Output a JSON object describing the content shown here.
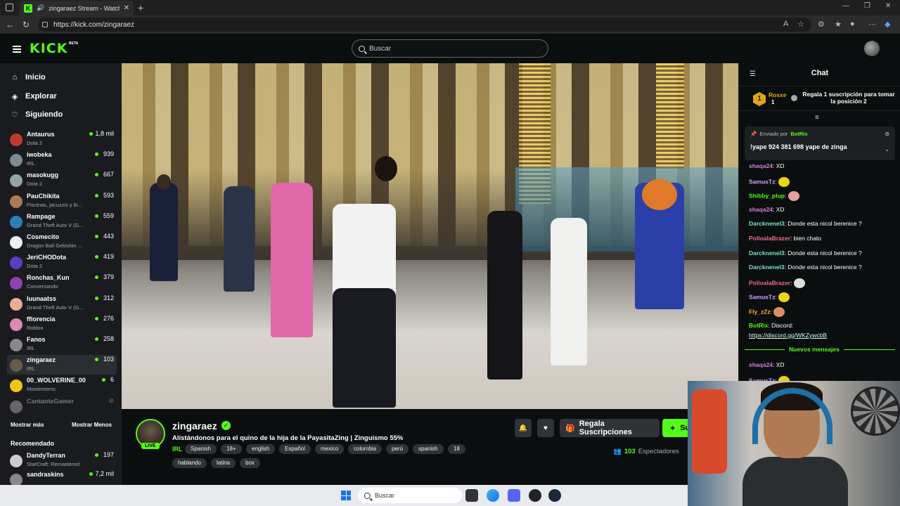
{
  "browser": {
    "tab_title": "zingaraez Stream - Watch Li",
    "url": "https://kick.com/zingaraez"
  },
  "header": {
    "logo": "KICK",
    "beta": "BETA",
    "search_placeholder": "Buscar"
  },
  "sidebar": {
    "nav": [
      {
        "label": "Inicio",
        "icon": "home-icon"
      },
      {
        "label": "Explorar",
        "icon": "compass-icon"
      },
      {
        "label": "Siguiendo",
        "icon": "heart-icon"
      }
    ],
    "channels": [
      {
        "name": "Antaurus",
        "category": "Dota 2",
        "viewers": "1,8 mil",
        "color": "#c0392b"
      },
      {
        "name": "iwobeka",
        "category": "IRL",
        "viewers": "939",
        "color": "#7f8c8d"
      },
      {
        "name": "masokugg",
        "category": "Dota 2",
        "viewers": "667",
        "color": "#95a5a6"
      },
      {
        "name": "PauChikita",
        "category": "Piscinas, jacuzzis y bi...",
        "viewers": "593",
        "color": "#b07a52"
      },
      {
        "name": "Rampage",
        "category": "Grand Theft Auto V (G...",
        "viewers": "559",
        "color": "#2980b9"
      },
      {
        "name": "Cosmecito",
        "category": "Dragon Ball Gekishin ...",
        "viewers": "443",
        "color": "#ecf0f1"
      },
      {
        "name": "JeriCHODota",
        "category": "Dota 2",
        "viewers": "419",
        "color": "#5b3cc4"
      },
      {
        "name": "Ronchas_Kun",
        "category": "Conversando",
        "viewers": "379",
        "color": "#8e44ad"
      },
      {
        "name": "luunaatss",
        "category": "Grand Theft Auto V (G...",
        "viewers": "312",
        "color": "#e8b090"
      },
      {
        "name": "ffiorencia",
        "category": "Roblox",
        "viewers": "276",
        "color": "#d98ab0"
      },
      {
        "name": "Fanos",
        "category": "IRL",
        "viewers": "258",
        "color": "#888888"
      },
      {
        "name": "zingaraez",
        "category": "IRL",
        "viewers": "103",
        "color": "#6a5a48",
        "active": true
      },
      {
        "name": "00_WOLVERINE_00",
        "category": "Movierooms",
        "viewers": "6",
        "color": "#f1c40f"
      },
      {
        "name": "CantanteGamer",
        "category": "",
        "viewers": "",
        "color": "#666666",
        "offline": true
      }
    ],
    "show_more": "Mostrar más",
    "show_less": "Mostrar Menos",
    "recommended_title": "Recomendado",
    "recommended": [
      {
        "name": "DandyTerran",
        "category": "StarCraft: Remastered",
        "viewers": "197",
        "color": "#cccccc"
      },
      {
        "name": "sandraskins",
        "category": "",
        "viewers": "7,2 mil",
        "color": "#888888"
      }
    ]
  },
  "stream": {
    "name": "zingaraez",
    "live_label": "LIVE",
    "title": "Alistándonos para el quino de la hija de la PayasitaZing  | Zinguismo 55%",
    "category": "IRL",
    "tags": [
      "Spanish",
      "18+",
      "english",
      "Español",
      "mexico",
      "colombia",
      "perú",
      "spanish",
      "18",
      "hablando",
      "latina",
      "box"
    ],
    "gift_button": "Regala Suscripciones",
    "sub_button": "Su",
    "viewers": "103",
    "viewers_label": "Espectadores"
  },
  "chat": {
    "title": "Chat",
    "leader": {
      "name": "Rosxe",
      "count": "1",
      "rank": "1",
      "text": "Regala 1 suscripción para tomar la posición 2"
    },
    "pinned": {
      "sent_by": "Enviado por",
      "user": "BotRix",
      "text": "!yape 924 381 698 yape de zinga"
    },
    "messages": [
      {
        "user": "shaqa24",
        "text": "XD",
        "color": "#d87be0"
      },
      {
        "user": "SamusTz",
        "text": "",
        "emote": "#f1d20f",
        "color": "#c8a6ff"
      },
      {
        "user": "Shibby_plup",
        "text": "",
        "emote": "#e8a0a0",
        "color": "#53fc18"
      },
      {
        "user": "shaqa24",
        "text": "XD",
        "color": "#d87be0"
      },
      {
        "user": "Darcknenel3",
        "text": "Donde esta nicol berenice ?",
        "color": "#7fe3c4"
      },
      {
        "user": "PolloalaBrazer",
        "text": "bien chato",
        "color": "#f06a8a"
      },
      {
        "user": "Darcknenel3",
        "text": "Donde esta nicol berenice ?",
        "color": "#7fe3c4"
      },
      {
        "user": "Darcknenel3",
        "text": "Donde esta nicol berenice ?",
        "color": "#7fe3c4"
      },
      {
        "user": "PolloalaBrazer",
        "text": "",
        "emote": "#dddddd",
        "color": "#f06a8a"
      },
      {
        "user": "SamusTz",
        "text": "",
        "emote": "#f1d20f",
        "color": "#c8a6ff"
      },
      {
        "user": "Fly_zZz",
        "text": "",
        "emote": "#d89060",
        "color": "#f5b041"
      },
      {
        "user": "BotRix",
        "text": "Discord:",
        "color": "#53fc18"
      }
    ],
    "discord_link": "https://discord.gg/WKZywcbB",
    "new_messages": "Nuevos mensajes",
    "after": [
      {
        "user": "shaqa24",
        "text": "XD",
        "color": "#d87be0"
      },
      {
        "user": "SamusTz",
        "text": "",
        "emote": "#f1d20f",
        "color": "#c8a6ff"
      }
    ]
  },
  "taskbar": {
    "search_placeholder": "Buscar"
  }
}
